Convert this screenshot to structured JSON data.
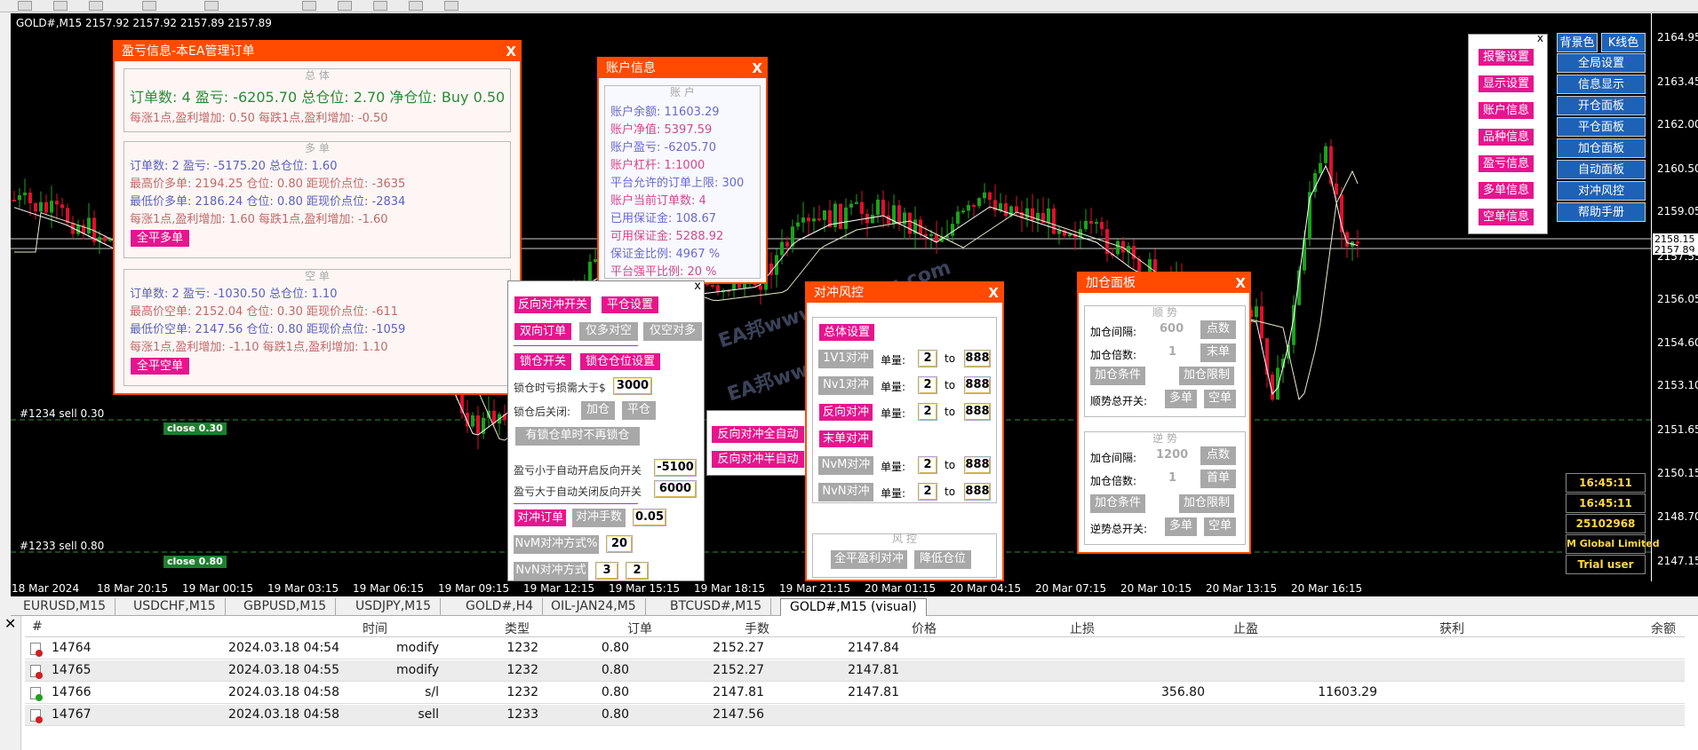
{
  "chart": {
    "symbol_line": "GOLD#,M15  2157.92  2157.92  2157.89  2157.89",
    "y_labels": [
      "2164.95",
      "2163.45",
      "2162.00",
      "2160.50",
      "2159.05",
      "2157.55",
      "2156.05",
      "2154.60",
      "2153.10",
      "2151.65",
      "2150.15",
      "2148.70",
      "2147.15"
    ],
    "price_marks": [
      "2158.15",
      "2157.89"
    ],
    "x_labels": [
      "18 Mar 2024",
      "18 Mar 20:15",
      "19 Mar 00:15",
      "19 Mar 03:15",
      "19 Mar 06:15",
      "19 Mar 09:15",
      "19 Mar 12:15",
      "19 Mar 15:15",
      "19 Mar 18:15",
      "19 Mar 21:15",
      "20 Mar 01:15",
      "20 Mar 04:15",
      "20 Mar 07:15",
      "20 Mar 10:15",
      "20 Mar 13:15",
      "20 Mar 16:15"
    ],
    "orders": [
      {
        "label": "#1234 sell 0.30",
        "close": "close 0.30"
      },
      {
        "label": "#1233 sell 0.80",
        "close": "close 0.80"
      }
    ],
    "watermark": "EA邦www.eabang.com",
    "colors": {
      "bull": "#1aa31a",
      "bear": "#e0102b",
      "bg": "#000000",
      "accent": "#ff4a00",
      "pink": "#e5158e"
    }
  },
  "profit_panel": {
    "title": "盈亏信息-本EA管理订单",
    "total_section": "总 体",
    "total_line": "订单数: 4   盈亏: -6205.70  总仓位: 2.70  净仓位: Buy 0.50",
    "total_line2": "每涨1点,盈利增加: 0.50    每跌1点,盈利增加: -0.50",
    "long_section": "多 单",
    "long_lines": [
      "订单数: 2  盈亏: -5175.20  总仓位: 1.60",
      "最高价多单: 2194.25  仓位: 0.80  距现价点位: -3635",
      "最低价多单: 2186.24  仓位: 0.80  距现价点位: -2834",
      "每涨1点,盈利增加: 1.60    每跌1点,盈利增加: -1.60"
    ],
    "long_btn": "全平多单",
    "short_section": "空 单",
    "short_lines": [
      "订单数: 2  盈亏: -1030.50  总仓位: 1.10",
      "最高价空单: 2152.04  仓位: 0.30  距现价点位: -611",
      "最低价空单: 2147.56  仓位: 0.80  距现价点位: -1059",
      "每涨1点,盈利增加: -1.10    每跌1点,盈利增加: 1.10"
    ],
    "short_btn": "全平空单"
  },
  "account_panel": {
    "title": "账户信息",
    "section": "账 户",
    "lines": [
      "账户余额: 11603.29",
      "账户净值: 5397.59",
      "账户盈亏: -6205.70",
      "账户杠杆: 1:1000",
      "平台允许的订单上限: 300",
      "账户当前订单数: 4",
      "已用保证金: 108.67",
      "可用保证金: 5288.92",
      "保证金比例: 4967 %",
      "平台强平比例: 20 %"
    ]
  },
  "lock_panel": {
    "btns": [
      "反向对冲开关",
      "平仓设置",
      "双向订单",
      "仅多对空",
      "仅空对多",
      "锁仓开关",
      "锁仓仓位设置"
    ],
    "lock_loss_label": "锁仓时亏损需大于$",
    "lock_loss_value": "3000",
    "after_lock_label": "锁仓后关闭:",
    "after_lock_btns": [
      "加仓",
      "平仓"
    ],
    "no_lock_btn": "有锁仓单时不再锁仓",
    "auto_open_label": "盈亏小于自动开启反向开关",
    "auto_open_value": "-5100",
    "auto_close_label": "盈亏大于自动关闭反向开关",
    "auto_close_value": "6000",
    "hedge_btn": "对冲订单",
    "hedge_lot_btn": "对冲手数",
    "hedge_lot_value": "0.05",
    "nvm_label": "NvM对冲方式%",
    "nvm_value": "20",
    "nvn_label": "NvN对冲方式",
    "nvn_v1": "3",
    "nvn_v2": "2"
  },
  "mini_panel": {
    "btns": [
      "反向对冲全自动",
      "反向对冲半自动"
    ]
  },
  "hedge_panel": {
    "title": "对冲风控",
    "total_btn": "总体设置",
    "rows": [
      {
        "btn": "1V1对冲",
        "lot_label": "单量:",
        "v1": "2",
        "to": "to",
        "v2": "888"
      },
      {
        "btn": "Nv1对冲",
        "lot_label": "单量:",
        "v1": "2",
        "to": "to",
        "v2": "888"
      },
      {
        "btn": "反向对冲",
        "lot_label": "单量:",
        "v1": "2",
        "to": "to",
        "v2": "888"
      },
      {
        "btn": "末单对冲"
      },
      {
        "btn": "NvM对冲",
        "lot_label": "单量:",
        "v1": "2",
        "to": "to",
        "v2": "888"
      },
      {
        "btn": "NvN对冲",
        "lot_label": "单量:",
        "v1": "2",
        "to": "to",
        "v2": "888"
      }
    ],
    "risk_section": "风 控",
    "risk_btns": [
      "全平盈利对冲",
      "降低仓位"
    ]
  },
  "add_panel": {
    "title": "加仓面板",
    "trend_section": "顺 势",
    "trend_interval_label": "加仓间隔:",
    "trend_interval_value": "600",
    "trend_interval_btn": "点数",
    "trend_mult_label": "加仓倍数:",
    "trend_mult_value": "1",
    "trend_mult_btn": "末单",
    "cond_btn": "加仓条件",
    "limit_btn": "加仓限制",
    "trend_switch_label": "顺势总开关:",
    "long_btn": "多单",
    "short_btn": "空单",
    "counter_section": "逆 势",
    "counter_interval_value": "1200",
    "counter_mult_btn": "首单",
    "counter_switch_label": "逆势总开关:"
  },
  "right_menu": {
    "pink_btns": [
      "报警设置",
      "显示设置",
      "账户信息",
      "品种信息",
      "盈亏信息",
      "多单信息",
      "空单信息"
    ],
    "top_btns": [
      "背景色",
      "K线色"
    ],
    "blue_btns": [
      "全局设置",
      "信息显示",
      "开仓面板",
      "平仓面板",
      "加仓面板",
      "自动面板",
      "对冲风控",
      "帮助手册"
    ],
    "info": [
      "16:45:11",
      "16:45:11",
      "25102968",
      "M Global Limited",
      "Trial user"
    ]
  },
  "tabs": [
    "EURUSD,M15",
    "USDCHF,M15",
    "GBPUSD,M15",
    "USDJPY,M15",
    "GOLD#,H4",
    "OIL-JAN24,M5",
    "BTCUSD#,M15",
    "GOLD#,M15 (visual)"
  ],
  "terminal": {
    "headers": [
      "#",
      "时间",
      "类型",
      "订单",
      "手数",
      "价格",
      "止损",
      "止盈",
      "获利",
      "余额"
    ],
    "rows": [
      {
        "id": "14764",
        "time": "2024.03.18 04:54",
        "type": "modify",
        "order": "1232",
        "lots": "0.80",
        "price": "2152.27",
        "sl": "2147.84",
        "tp": "",
        "profit": "",
        "balance": "",
        "icon": "red"
      },
      {
        "id": "14765",
        "time": "2024.03.18 04:55",
        "type": "modify",
        "order": "1232",
        "lots": "0.80",
        "price": "2152.27",
        "sl": "2147.81",
        "tp": "",
        "profit": "",
        "balance": "",
        "icon": "red"
      },
      {
        "id": "14766",
        "time": "2024.03.18 04:58",
        "type": "s/l",
        "order": "1232",
        "lots": "0.80",
        "price": "2147.81",
        "sl": "2147.81",
        "tp": "",
        "profit": "356.80",
        "balance": "11603.29",
        "icon": "green"
      },
      {
        "id": "14767",
        "time": "2024.03.18 04:58",
        "type": "sell",
        "order": "1233",
        "lots": "0.80",
        "price": "2147.56",
        "sl": "",
        "tp": "",
        "profit": "",
        "balance": "",
        "icon": "red"
      }
    ]
  }
}
